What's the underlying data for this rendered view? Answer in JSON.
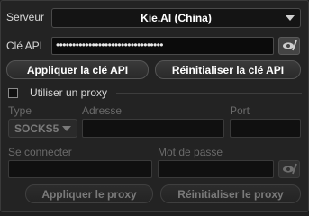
{
  "server": {
    "label": "Serveur",
    "value": "Kie.AI (China)"
  },
  "api_key": {
    "label": "Clé API",
    "value": "•••••••••••••••••••••••••••••••••"
  },
  "buttons": {
    "apply_key": "Appliquer la clé API",
    "reset_key": "Réinitialiser la clé API",
    "apply_proxy": "Appliquer le proxy",
    "reset_proxy": "Réinitialiser le proxy"
  },
  "proxy": {
    "use_label": "Utiliser un proxy",
    "type_label": "Type",
    "type_value": "SOCKS5",
    "address_label": "Adresse",
    "port_label": "Port",
    "login_label": "Se connecter",
    "password_label": "Mot de passe"
  }
}
